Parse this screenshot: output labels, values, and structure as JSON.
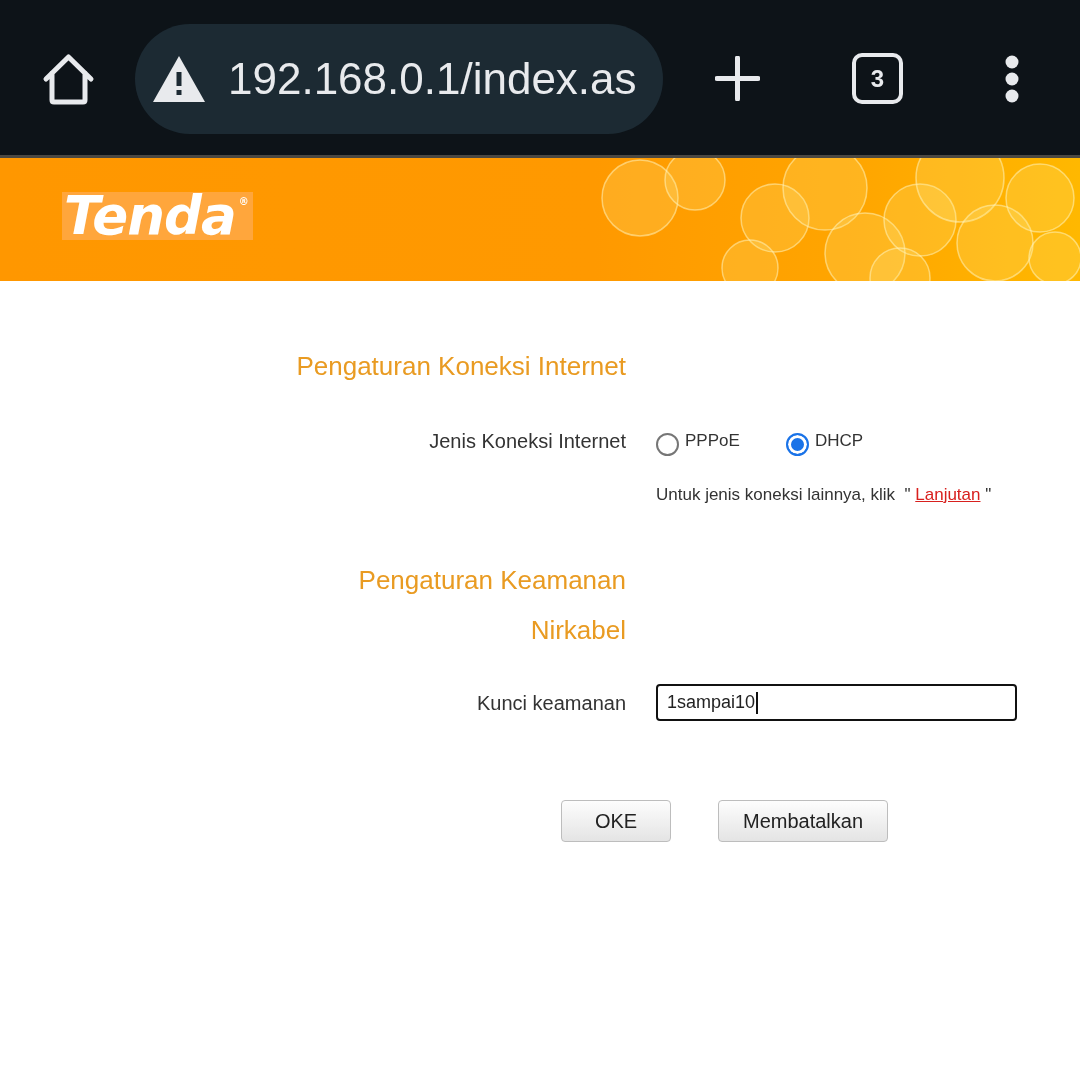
{
  "browser_bar": {
    "insecure": true,
    "url": "192.168.0.1/index.as",
    "tab_count": "3"
  },
  "header": {
    "logo": "Tenda$^{®}$"
  },
  "sections": [
    {
      "kind": "heading",
      "text": "Pengaturan Koneksi Internet"
    },
    {
      "kind": "radio_row",
      "label": "Jenis Koneksi Internet",
      "options": [
        {
          "label": "PPPoE",
          "selected": false
        },
        {
          "label": "DHCP",
          "selected": true
        }
      ]
    },
    {
      "kind": "hint",
      "prefix": "Untuk jenis koneksi lainnya, klik  \" ",
      "link": "Lanjutan",
      "suffix": " \""
    },
    {
      "kind": "heading",
      "text": "Pengaturan Keamanan Nirkabel"
    },
    {
      "kind": "field_row",
      "label": "Kunci keamanan",
      "value": "1sampai10",
      "focused": true
    }
  ],
  "buttons": [
    "OKE",
    "Membatalkan"
  ]
}
